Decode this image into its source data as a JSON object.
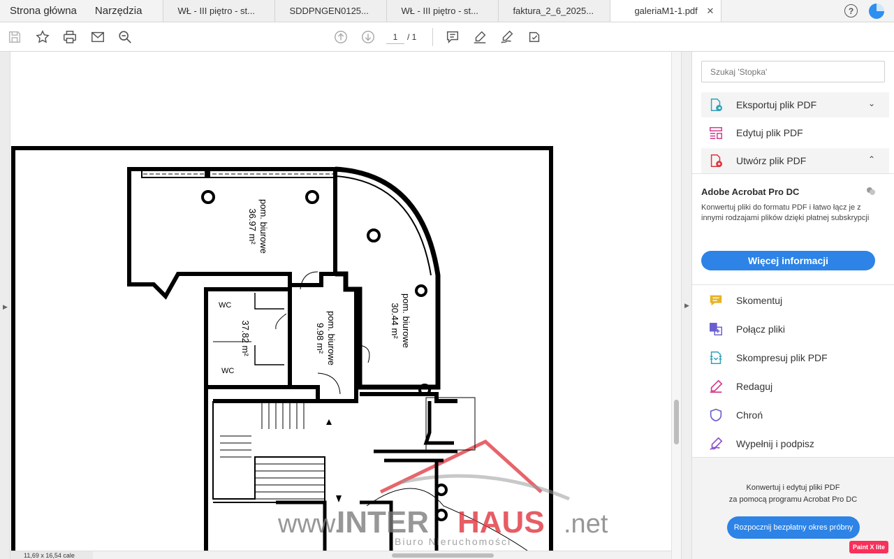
{
  "tabbar": {
    "home": "Strona główna",
    "tools": "Narzędzia",
    "tabs": [
      {
        "label": "WŁ - III piętro - st..."
      },
      {
        "label": "SDDPNGEN0125..."
      },
      {
        "label": "WŁ - III piętro - st..."
      },
      {
        "label": "faktura_2_6_2025..."
      },
      {
        "label": "galeriaM1-1.pdf",
        "active": true
      }
    ],
    "close_glyph": "✕",
    "help_glyph": "?"
  },
  "toolbar": {
    "page_current": "1",
    "page_total": "/ 1"
  },
  "document": {
    "rooms": [
      {
        "name": "pom. biurowe",
        "area": "36.97 m²"
      },
      {
        "name": "pom. biurowe",
        "area": "30.44 m²"
      },
      {
        "name": "pom. biurowe",
        "area": "9.98 m²"
      },
      {
        "area": "37.82 m²"
      }
    ],
    "wc_labels": [
      "WC",
      "WC"
    ],
    "watermark": {
      "site_prefix": "www.",
      "brand_1": "INTER",
      "brand_2": "HAUS",
      "site_suffix": ".net",
      "tagline": "Biuro Nieruchomości"
    },
    "page_size": "11,69 x 16,54 cale"
  },
  "rightpane": {
    "search_placeholder": "Szukaj 'Stopka'",
    "top_tools": [
      {
        "label": "Eksportuj plik PDF",
        "icon": "export-pdf-icon",
        "chevron": "⌄"
      },
      {
        "label": "Edytuj plik PDF",
        "icon": "edit-pdf-icon"
      },
      {
        "label": "Utwórz plik PDF",
        "icon": "create-pdf-icon",
        "chevron": "⌃"
      }
    ],
    "promo": {
      "title": "Adobe Acrobat Pro DC",
      "description": "Konwertuj pliki do formatu PDF i łatwo łącz je z innymi rodzajami plików dzięki płatnej subskrypcji",
      "button": "Więcej informacji"
    },
    "tools": [
      {
        "label": "Skomentuj",
        "icon": "comment-icon",
        "color": "#e8b424"
      },
      {
        "label": "Połącz pliki",
        "icon": "combine-files-icon",
        "color": "#6a5fd0"
      },
      {
        "label": "Skompresuj plik PDF",
        "icon": "compress-pdf-icon",
        "color": "#2fa2b8"
      },
      {
        "label": "Redaguj",
        "icon": "redact-icon",
        "color": "#d4378a"
      },
      {
        "label": "Chroń",
        "icon": "protect-icon",
        "color": "#6a5fd0"
      },
      {
        "label": "Wypełnij i podpisz",
        "icon": "fill-sign-icon",
        "color": "#8a4fd0"
      }
    ],
    "bottom_promo": {
      "line1": "Konwertuj i edytuj pliki PDF",
      "line2": "za pomocą programu Acrobat Pro DC",
      "button": "Rozpocznij bezpłatny okres próbny"
    },
    "badge": "Paint X lite"
  },
  "colors": {
    "accent_blue": "#2d83e6",
    "watermark_red": "#e0303a",
    "watermark_gray": "#7a7a7a"
  }
}
